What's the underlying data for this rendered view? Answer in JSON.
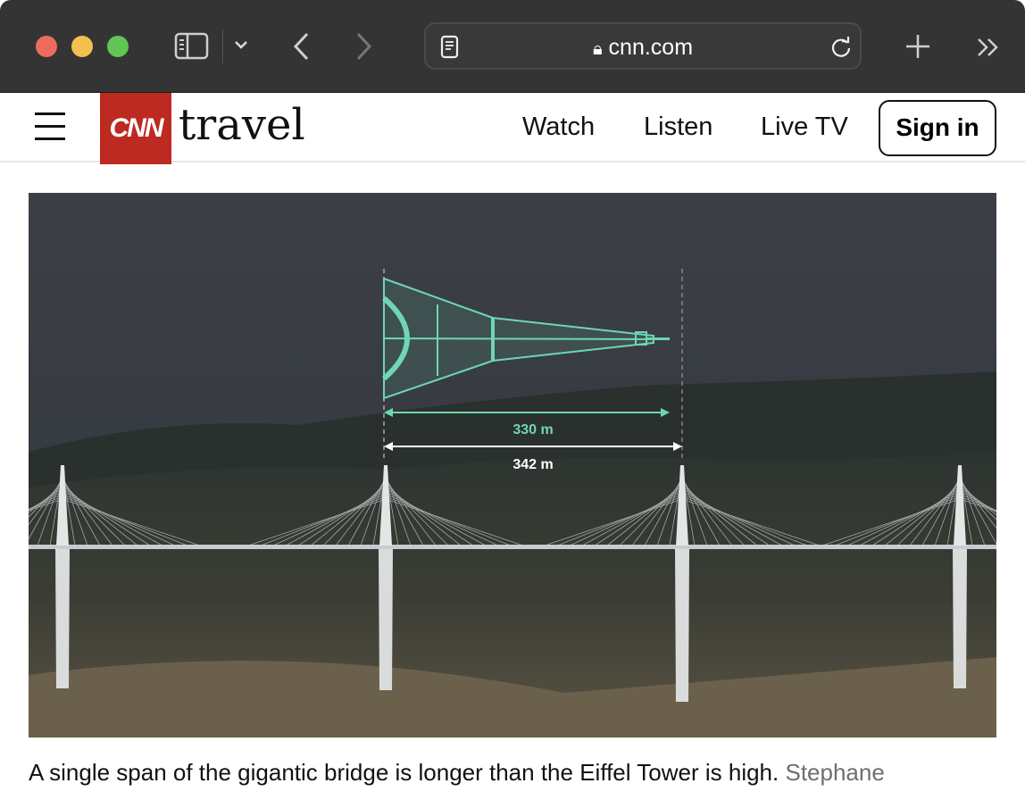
{
  "browser": {
    "url": "cnn.com",
    "traffic_lights": {
      "close": "#ec6a5e",
      "minimize": "#f4bf4f",
      "maximize": "#61c554"
    }
  },
  "header": {
    "logo": "CNN",
    "section": "travel",
    "nav": [
      "Watch",
      "Listen",
      "Live TV"
    ],
    "sign_in": "Sign in",
    "brand_color": "#bd2a22"
  },
  "hero": {
    "labels": {
      "tower_height": "330 m",
      "span_length": "342 m"
    },
    "accent": "#6fd6b3"
  },
  "caption": {
    "text": "A single span of the gigantic bridge is longer than the Eiffel Tower is high.",
    "credit": "Stephane"
  }
}
